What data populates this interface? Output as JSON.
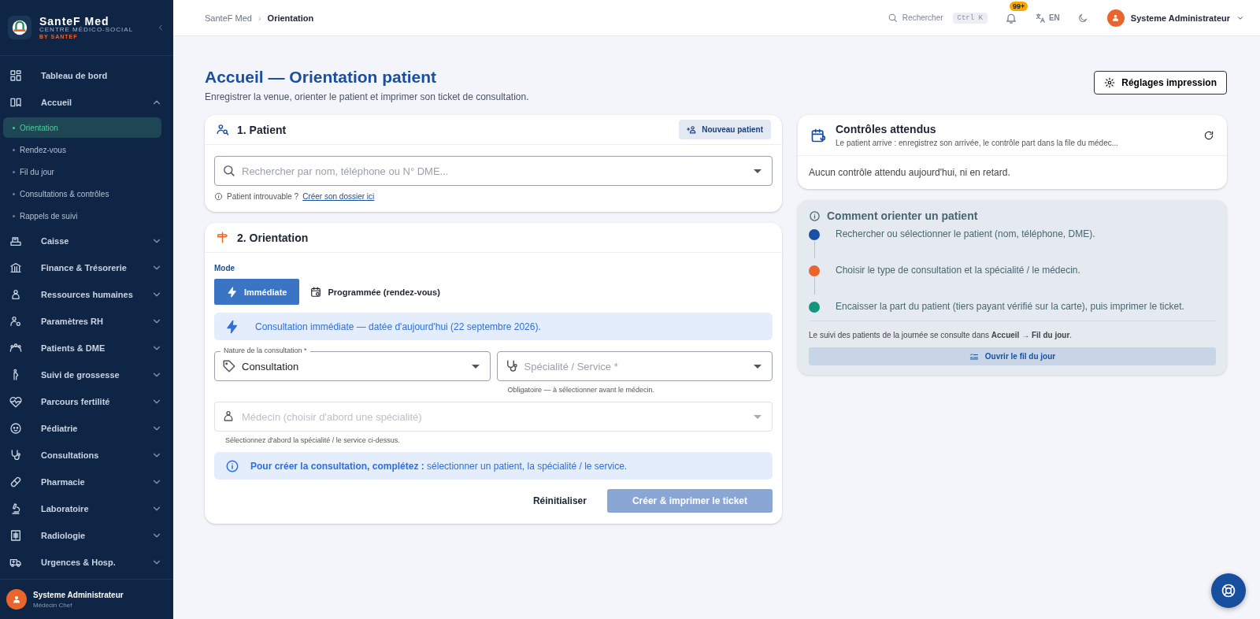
{
  "sidebar": {
    "brand": {
      "name": "SanteF Med",
      "subtitle": "CENTRE MÉDICO-SOCIAL",
      "tagline": "BY SANTEF"
    },
    "items": [
      {
        "kind": "link",
        "label": "Tableau de bord"
      },
      {
        "kind": "group",
        "label": "Accueil",
        "expanded": true,
        "children": [
          {
            "label": "Orientation",
            "selected": true
          },
          {
            "label": "Rendez-vous",
            "selected": false
          },
          {
            "label": "Fil du jour",
            "selected": false
          },
          {
            "label": "Consultations & contrôles",
            "selected": false
          },
          {
            "label": "Rappels de suivi",
            "selected": false
          }
        ]
      },
      {
        "kind": "group",
        "label": "Caisse",
        "expanded": false
      },
      {
        "kind": "group",
        "label": "Finance & Trésorerie",
        "expanded": false
      },
      {
        "kind": "group",
        "label": "Ressources humaines",
        "expanded": false
      },
      {
        "kind": "group",
        "label": "Paramètres RH",
        "expanded": false
      },
      {
        "kind": "group",
        "label": "Patients & DME",
        "expanded": false
      },
      {
        "kind": "group",
        "label": "Suivi de grossesse",
        "expanded": false
      },
      {
        "kind": "group",
        "label": "Parcours fertilité",
        "expanded": false
      },
      {
        "kind": "group",
        "label": "Pédiatrie",
        "expanded": false
      },
      {
        "kind": "group",
        "label": "Consultations",
        "expanded": false
      },
      {
        "kind": "group",
        "label": "Pharmacie",
        "expanded": false
      },
      {
        "kind": "group",
        "label": "Laboratoire",
        "expanded": false
      },
      {
        "kind": "group",
        "label": "Radiologie",
        "expanded": false
      },
      {
        "kind": "group",
        "label": "Urgences & Hosp.",
        "expanded": false
      }
    ],
    "user": {
      "name": "Systeme Administrateur",
      "role": "Médecin Chef"
    }
  },
  "topbar": {
    "breadcrumb": [
      "SanteF Med",
      "Orientation"
    ],
    "breadcrumb_separator": "›",
    "search_label": "Rechercher",
    "shortcut": "Ctrl K",
    "notification_badge": "99+",
    "language": "EN",
    "user_name": "Systeme Administrateur"
  },
  "page": {
    "title": "Accueil — Orientation patient",
    "subtitle": "Enregistrer la venue, orienter le patient et imprimer son ticket de consultation.",
    "print_button": "Réglages impression"
  },
  "patient_card": {
    "title": "1. Patient",
    "new_button": "Nouveau patient",
    "search_placeholder": "Rechercher par nom, téléphone ou N° DME...",
    "hint": "Patient introuvable ?",
    "hint_link": "Créer son dossier ici"
  },
  "orientation": {
    "title": "2. Orientation",
    "mode_label": "Mode",
    "modes": [
      {
        "label": "Immédiate",
        "selected": true
      },
      {
        "label": "Programmée (rendez-vous)",
        "selected": false
      }
    ],
    "banner": "Consultation immédiate — datée d'aujourd'hui (22 septembre 2026).",
    "nature": {
      "label": "Nature de la consultation *",
      "value": "Consultation"
    },
    "speciality": {
      "placeholder": "Spécialité / Service *",
      "helper": "Obligatoire — à sélectionner avant le médecin."
    },
    "doctor": {
      "placeholder": "Médecin (choisir d'abord une spécialité)",
      "helper": "Sélectionnez d'abord la spécialité / le service ci-dessus.",
      "disabled": true
    },
    "notice": "**Pour créer la consultation, complétez :** sélectionner un patient, la spécialité / le service.",
    "reset_button": "Réinitialiser",
    "submit": {
      "label": "Créer & imprimer le ticket",
      "disabled": true
    }
  },
  "controls_card": {
    "title": "Contrôles attendus",
    "subtitle": "Le patient arrive : enregistrez son arrivée, le contrôle part dans la file du médec...",
    "empty": "Aucun contrôle attendu aujourd'hui, ni en retard."
  },
  "guide": {
    "title": "Comment orienter un patient",
    "steps": [
      {
        "text": "Rechercher ou sélectionner le patient (nom, téléphone, DME).",
        "color": "#1a4fa8"
      },
      {
        "text": "Choisir le type de consultation et la spécialité / le médecin.",
        "color": "#e8652b"
      },
      {
        "text": "Encaisser la part du patient (tiers payant vérifié sur la carte), puis imprimer le ticket.",
        "color": "#14957e"
      }
    ],
    "note": "Le suivi des patients de la journée se consulte dans **Accueil → Fil du jour**.",
    "button": "Ouvrir le fil du jour"
  }
}
